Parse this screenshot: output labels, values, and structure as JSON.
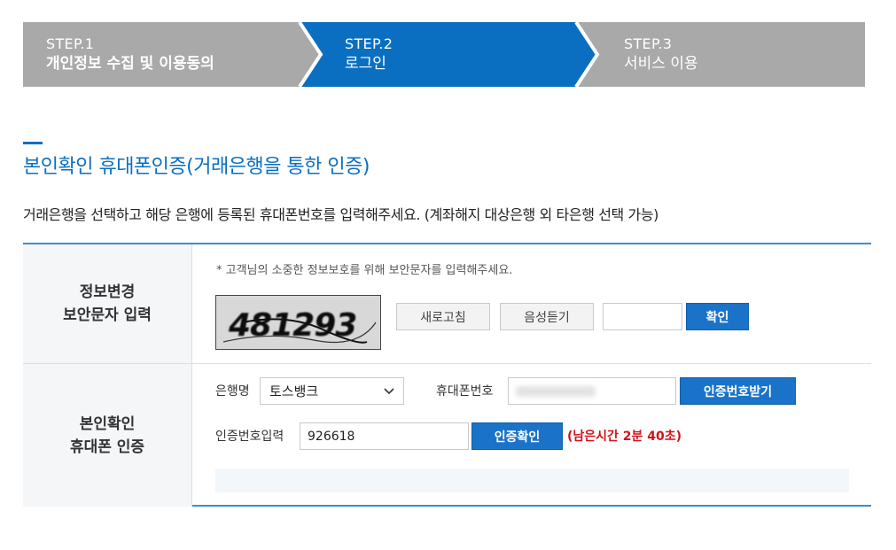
{
  "steps": [
    {
      "num": "STEP.1",
      "label": "개인정보 수집 및 이용동의",
      "state": "done"
    },
    {
      "num": "STEP.2",
      "label": "로그인",
      "state": "active"
    },
    {
      "num": "STEP.3",
      "label": "서비스 이용",
      "state": "pending"
    }
  ],
  "colors": {
    "active": "#0a6fc1",
    "inactive": "#a9a9a9",
    "accent": "#1a73c9",
    "timer": "#d0121a"
  },
  "title": "본인확인 휴대폰인증(거래은행을 통한 인증)",
  "instruction": "거래은행을 선택하고 해당 은행에 등록된 휴대폰번호를 입력해주세요. (계좌해지 대상은행 외 타은행 선택 가능)",
  "security": {
    "header": "정보변경\n보안문자 입력",
    "note": "* 고객님의 소중한 정보보호를 위해 보안문자를 입력해주세요.",
    "captcha_text": "481293",
    "refresh_label": "새로고침",
    "audio_label": "음성듣기",
    "input_value": "",
    "confirm_label": "확인"
  },
  "phone_auth": {
    "header": "본인확인\n휴대폰 인증",
    "bank_label": "은행명",
    "bank_value": "토스뱅크",
    "phone_label": "휴대폰번호",
    "phone_value": "",
    "request_code_label": "인증번호받기",
    "code_label": "인증번호입력",
    "code_value": "926618",
    "verify_label": "인증확인",
    "timer": "(남은시간 2분 40초)"
  }
}
